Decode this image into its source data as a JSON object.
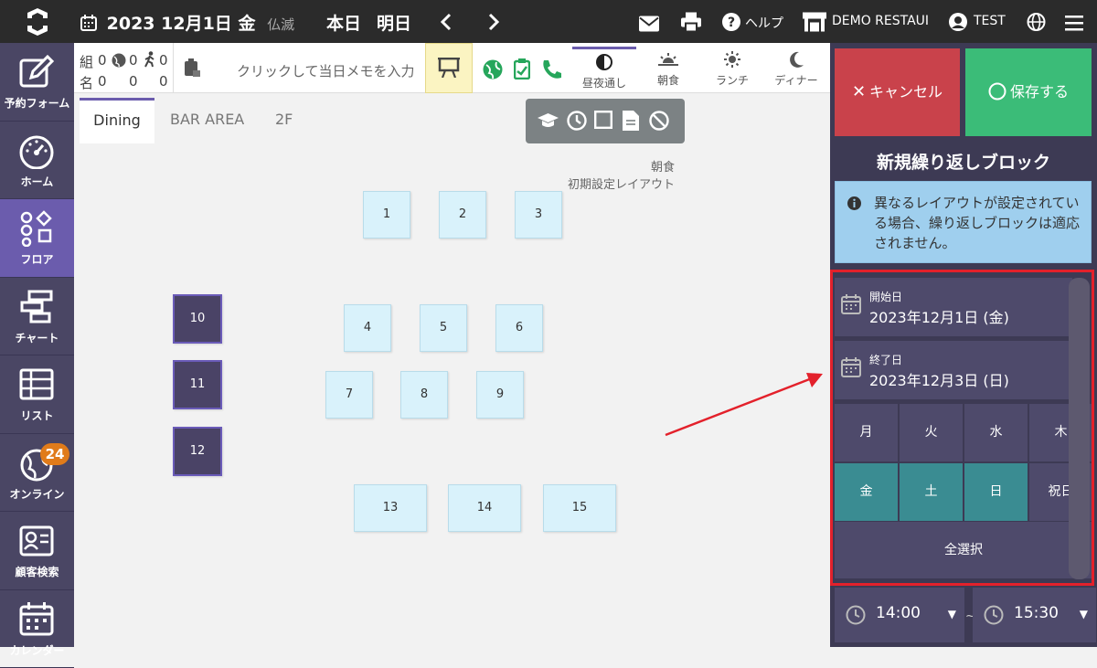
{
  "header": {
    "year": "2023",
    "date": "12月1日",
    "weekday": "金",
    "rokuyo": "仏滅",
    "today": "本日",
    "tomorrow": "明日",
    "help": "ヘルプ",
    "restaurant": "DEMO RESTAUI",
    "user": "TEST"
  },
  "sidebar": {
    "items": [
      {
        "label": "予約フォーム"
      },
      {
        "label": "ホーム"
      },
      {
        "label": "フロア"
      },
      {
        "label": "チャート"
      },
      {
        "label": "リスト"
      },
      {
        "label": "オンライン",
        "badge": "24"
      },
      {
        "label": "顧客検索"
      },
      {
        "label": "カレンダー"
      }
    ]
  },
  "info": {
    "groups_label": "組",
    "people_label": "名",
    "groups": [
      "0",
      "0",
      "0"
    ],
    "people": [
      "0",
      "0",
      "0"
    ],
    "memo_placeholder": "クリックして当日メモを入力"
  },
  "segments": [
    {
      "label": "昼夜通し",
      "icon": "half-circle-icon"
    },
    {
      "label": "朝食",
      "icon": "sunrise-icon"
    },
    {
      "label": "ランチ",
      "icon": "sun-icon"
    },
    {
      "label": "ディナー",
      "icon": "moon-icon"
    }
  ],
  "tabs": [
    "Dining",
    "BAR AREA",
    "2F"
  ],
  "layout": {
    "meal": "朝食",
    "name": "初期設定レイアウト"
  },
  "tables": [
    "1",
    "2",
    "3",
    "4",
    "5",
    "6",
    "7",
    "8",
    "9",
    "10",
    "11",
    "12",
    "13",
    "14",
    "15"
  ],
  "panel": {
    "cancel": "キャンセル",
    "save": "保存する",
    "title": "新規繰り返しブロック",
    "alert": "異なるレイアウトが設定されている場合、繰り返しブロックは適応されません。",
    "start_label": "開始日",
    "start_value": "2023年12月1日 (金)",
    "end_label": "終了日",
    "end_value": "2023年12月3日 (日)",
    "days": [
      "月",
      "火",
      "水",
      "木",
      "金",
      "土",
      "日",
      "祝日"
    ],
    "select_all": "全選択",
    "time_from": "14:00",
    "time_sep": "~",
    "time_to": "15:30"
  },
  "colors": {
    "topbar": "#2b2b2b",
    "sidebar": "#4a4664",
    "sidebar_active": "#6b5cad",
    "cancel": "#c9424b",
    "save": "#3bbc78",
    "selected_day": "#3a8c92",
    "highlight": "#e3212b"
  }
}
